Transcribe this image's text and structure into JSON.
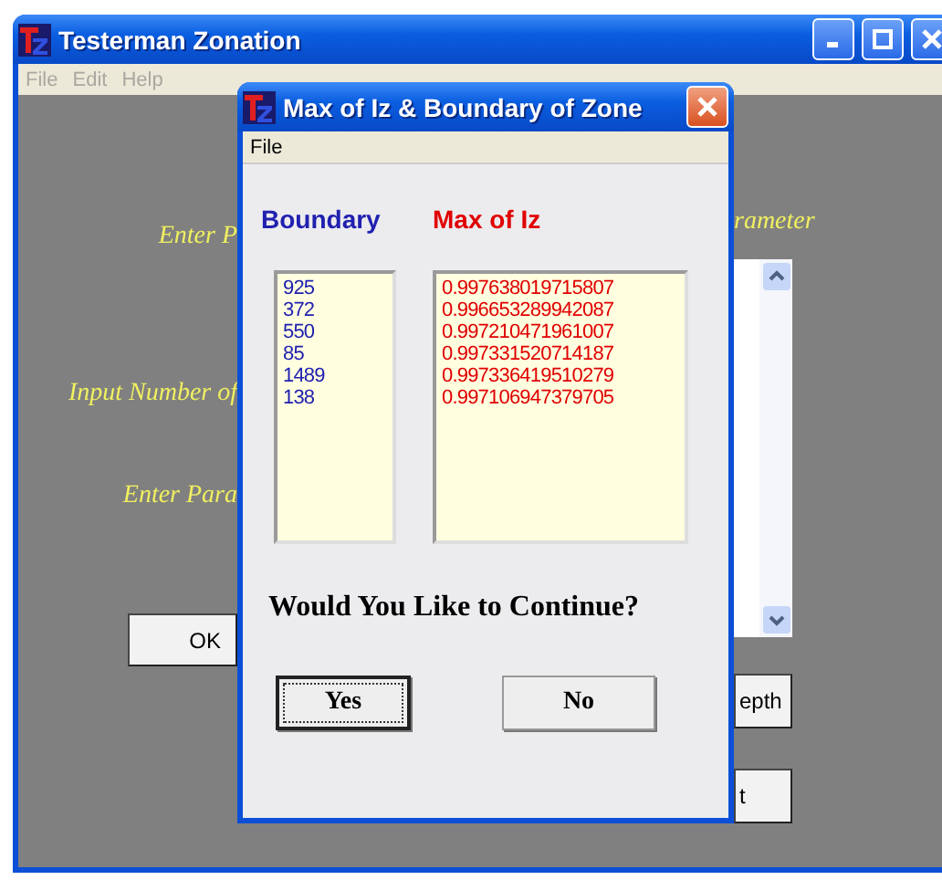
{
  "main_window": {
    "title": "Testerman Zonation",
    "menu": [
      {
        "label": "File",
        "disabled": true
      },
      {
        "label": "Edit",
        "disabled": true
      },
      {
        "label": "Help",
        "disabled": true
      }
    ],
    "left_labels": [
      "Enter P",
      "Input Number of",
      "Enter Para"
    ],
    "ok_button": "OK",
    "right_label": "rameter",
    "right_buttons": [
      "epth",
      "t"
    ]
  },
  "dialog": {
    "title": "Max of Iz & Boundary of Zone",
    "menu": [
      "File"
    ],
    "columns": [
      {
        "heading": "Boundary",
        "color": "#2020b0",
        "values": [
          "925",
          "372",
          "550",
          "85",
          "1489",
          "138"
        ]
      },
      {
        "heading": "Max of Iz",
        "color": "#e00000",
        "values": [
          "0.997638019715807",
          "0.996653289942087",
          "0.997210471961007",
          "0.997331520714187",
          "0.997336419510279",
          "0.997106947379705"
        ]
      }
    ],
    "question": "Would You Like to Continue?",
    "buttons": [
      {
        "label": "Yes",
        "selected": true
      },
      {
        "label": "No",
        "selected": false
      }
    ]
  }
}
